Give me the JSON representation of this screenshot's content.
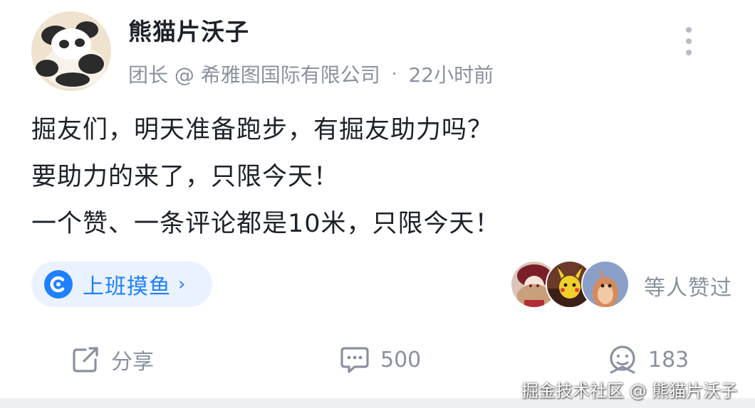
{
  "post": {
    "author": {
      "name": "熊猫片沃子",
      "title": "团长 @ 希雅图国际有限公司"
    },
    "time_separator": "·",
    "timestamp": "22小时前",
    "content_lines": [
      "掘友们，明天准备跑步，有掘友助力吗？",
      "要助力的来了，只限今天！",
      "一个赞、一条评论都是10米，只限今天！"
    ],
    "circle_tag": {
      "label": "上班摸鱼",
      "chevron": "›",
      "icon": "circle-logo-icon"
    },
    "likes_summary": {
      "text": "等人赞过",
      "avatar_count": 3
    },
    "actions": {
      "share_label": "分享",
      "comment_count": "500",
      "like_count": "183"
    }
  },
  "watermark": "掘金技术社区 @ 熊猫片沃子",
  "colors": {
    "accent": "#1e80ff",
    "tag_bg": "#eaf2ff",
    "meta_text": "#8a919f",
    "body_text": "#1d2129",
    "icon_gray": "#8a919f"
  }
}
